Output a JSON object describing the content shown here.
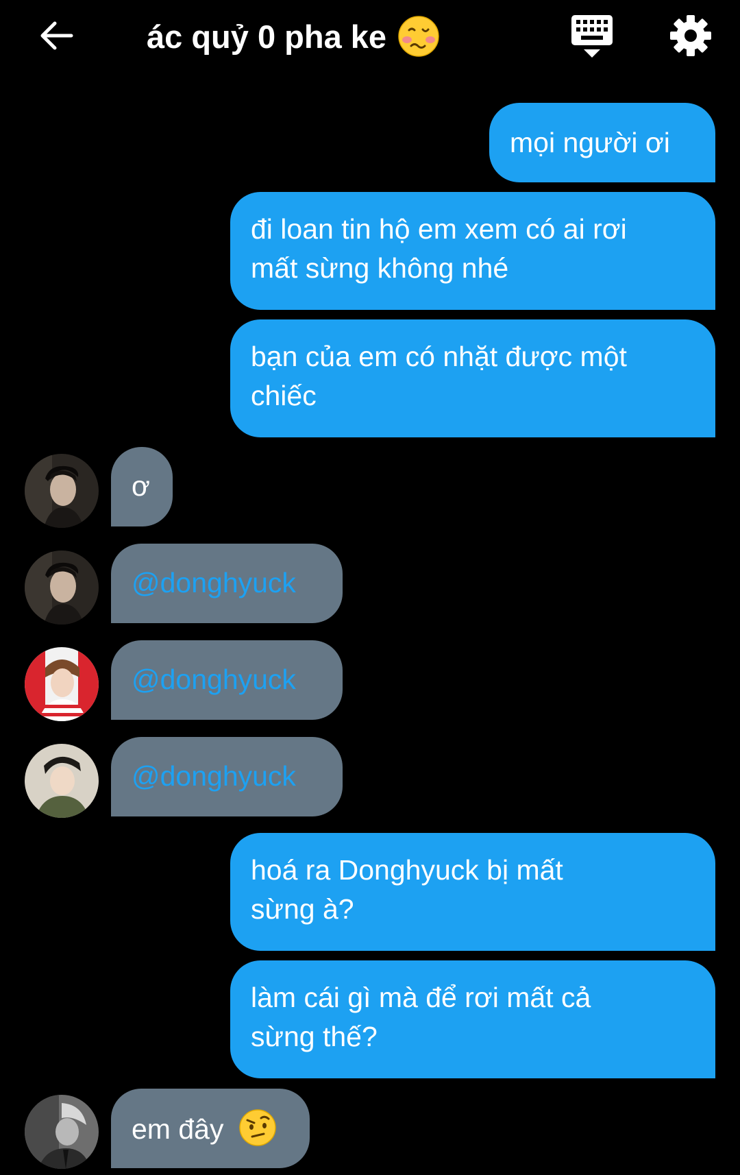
{
  "header": {
    "title": "ác quỷ 0 pha ke",
    "title_emoji": "woozy-face-emoji",
    "back_icon": "arrow-left-icon",
    "keyboard_icon": "keyboard-icon",
    "settings_icon": "gear-icon"
  },
  "colors": {
    "background": "#000000",
    "outgoing_bubble": "#1da1f2",
    "incoming_bubble": "#657786",
    "mention": "#1da1f2"
  },
  "messages": [
    {
      "direction": "outgoing",
      "lines": [
        "mọi người ơi"
      ]
    },
    {
      "direction": "outgoing",
      "lines": [
        "đi loan tin hộ em xem có ai rơi",
        "mất sừng không nhé"
      ]
    },
    {
      "direction": "outgoing",
      "lines": [
        "bạn của em có nhặt được một",
        "chiếc"
      ]
    },
    {
      "direction": "incoming",
      "text": "ơ",
      "avatar": "avatar-user-1"
    },
    {
      "direction": "incoming",
      "text": "@donghyuck",
      "avatar": "avatar-user-1"
    },
    {
      "direction": "incoming",
      "text": "@donghyuck",
      "avatar": "avatar-user-2"
    },
    {
      "direction": "incoming",
      "text": "@donghyuck",
      "avatar": "avatar-user-3"
    },
    {
      "direction": "outgoing",
      "lines": [
        "hoá ra Donghyuck bị mất",
        "sừng à?"
      ]
    },
    {
      "direction": "outgoing",
      "lines": [
        "làm cái gì mà để rơi mất cả",
        "sừng thế?"
      ]
    },
    {
      "direction": "incoming",
      "text": "em đây",
      "emoji": "face-with-raised-eyebrow-emoji",
      "avatar": "avatar-user-4"
    }
  ]
}
